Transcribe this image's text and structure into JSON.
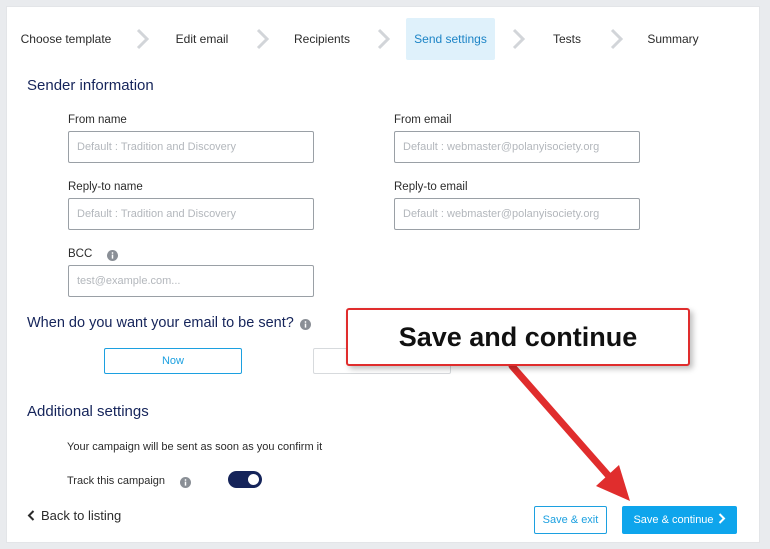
{
  "stepper": {
    "steps": [
      {
        "label": "Choose template"
      },
      {
        "label": "Edit email"
      },
      {
        "label": "Recipients"
      },
      {
        "label": "Send settings"
      },
      {
        "label": "Tests"
      },
      {
        "label": "Summary"
      }
    ],
    "active_index": 3
  },
  "sender": {
    "title": "Sender information",
    "from_name": {
      "label": "From name",
      "placeholder": "Default : Tradition and Discovery",
      "value": ""
    },
    "from_email": {
      "label": "From email",
      "placeholder": "Default : webmaster@polanyisociety.org",
      "value": ""
    },
    "reply_to_name": {
      "label": "Reply-to name",
      "placeholder": "Default : Tradition and Discovery",
      "value": ""
    },
    "reply_to_email": {
      "label": "Reply-to email",
      "placeholder": "Default : webmaster@polanyisociety.org",
      "value": ""
    },
    "bcc": {
      "label": "BCC",
      "placeholder": "test@example.com...",
      "value": ""
    }
  },
  "schedule": {
    "title": "When do you want your email to be sent?",
    "now_label": "Now",
    "later_label": ""
  },
  "additional": {
    "title": "Additional settings",
    "info_text": "Your campaign will be sent as soon as you confirm it",
    "track_label": "Track this campaign",
    "track_enabled": true
  },
  "footer": {
    "back_label": "Back to listing",
    "save_exit_label": "Save & exit",
    "save_continue_label": "Save & continue"
  },
  "annotation": {
    "callout_text": "Save and continue"
  },
  "colors": {
    "accent": "#0ea5ec",
    "navy": "#15245a",
    "active_step_bg": "#dff1fb",
    "annotation_red": "#e02d2d"
  }
}
